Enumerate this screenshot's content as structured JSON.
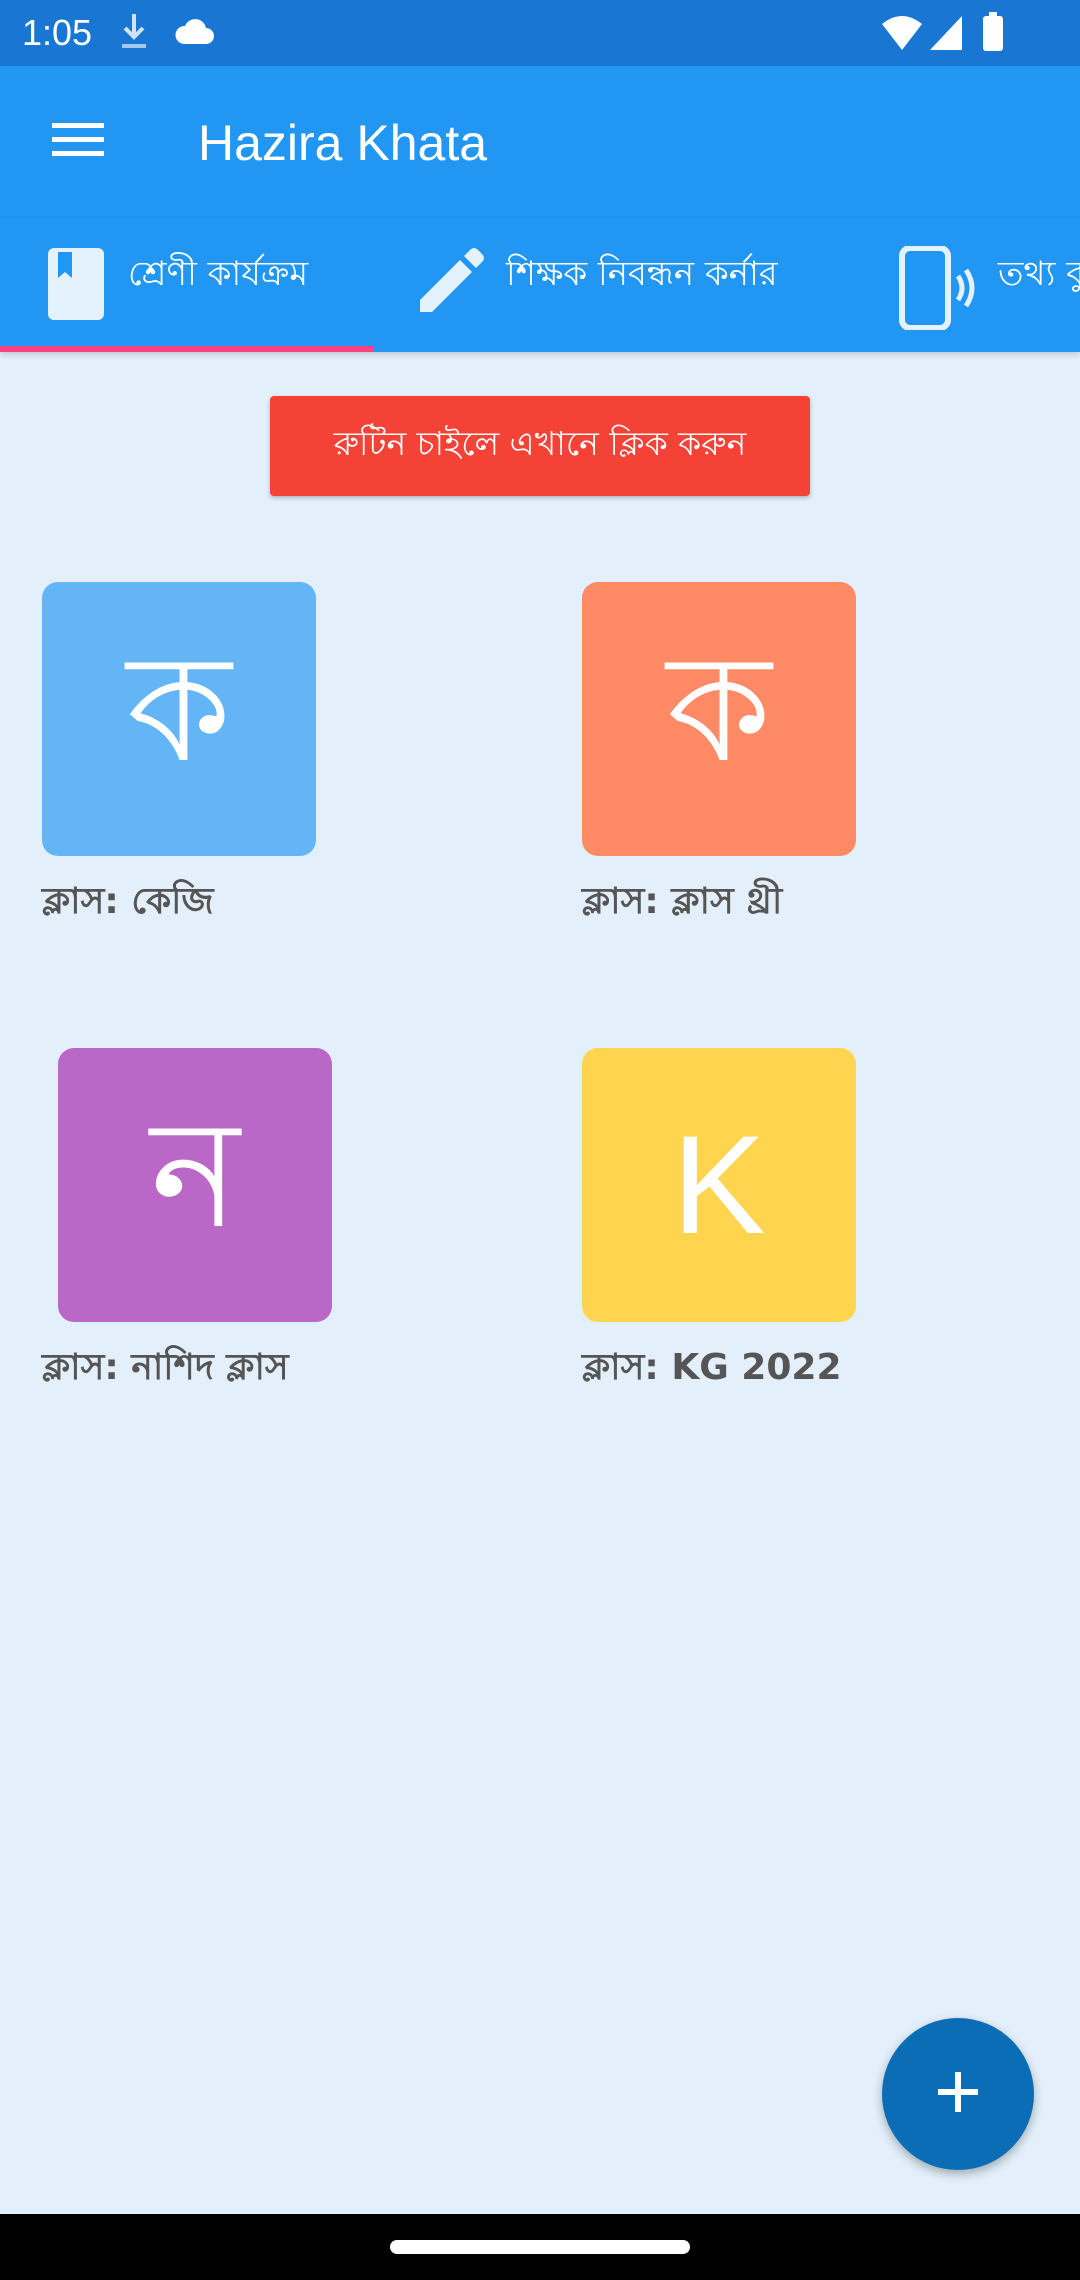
{
  "status_bar": {
    "time": "1:05",
    "icons": [
      "download-icon",
      "cloud-icon",
      "wifi-icon",
      "signal-icon",
      "battery-icon"
    ]
  },
  "app_bar": {
    "title": "Hazira Khata",
    "menu_icon": "hamburger-menu-icon"
  },
  "tabs": [
    {
      "label": "শ্রেণী কার্যক্রম",
      "icon": "book-icon",
      "selected": true
    },
    {
      "label": "শিক্ষক নিবন্ধন কর্নার",
      "icon": "pencil-icon",
      "selected": false
    },
    {
      "label": "তথ্য বু",
      "icon": "phone-vibrate-icon",
      "selected": false
    }
  ],
  "routine_button": {
    "label": "রুটিন চাইলে এখানে ক্লিক করুন"
  },
  "classes": [
    {
      "initial": "ক",
      "label": "ক্লাস: কেজি",
      "color": "#64B5F6"
    },
    {
      "initial": "ক",
      "label": "ক্লাস: ক্লাস থ্রী",
      "color": "#FF8A65"
    },
    {
      "initial": "ন",
      "label": "ক্লাস: নাশিদ ক্লাস",
      "color": "#BA68C8"
    },
    {
      "initial": "K",
      "label": "ক্লাস: KG 2022",
      "color": "#FFD54F"
    }
  ],
  "fab": {
    "icon": "plus-icon"
  },
  "colors": {
    "primary": "#2196F3",
    "status_bar": "#1976D2",
    "background": "#E3F0FB",
    "tab_indicator": "#FF4081",
    "routine_button": "#F44336",
    "fab": "#0B6DB5"
  }
}
